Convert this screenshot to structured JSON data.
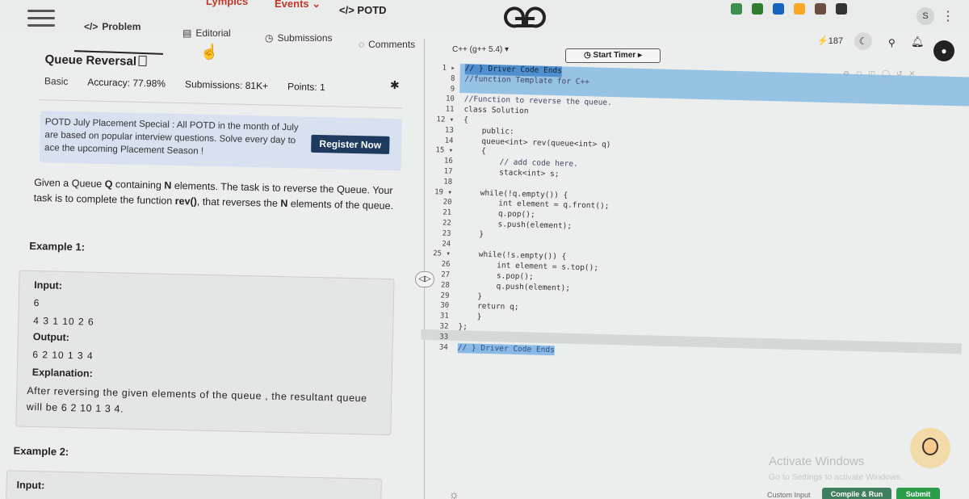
{
  "topbar": {
    "nav_olympics": "Lympics",
    "nav_events": "Events",
    "nav_potd": "POTD",
    "extensions": [
      "#3c8d4e",
      "#2e7d32",
      "#1565c0",
      "#f9a825",
      "#6d4c41",
      "#333333"
    ],
    "profile_initial": "S",
    "streak_count": "187"
  },
  "tabs": [
    {
      "label": "Problem",
      "icon": "code-icon"
    },
    {
      "label": "Editorial",
      "icon": "doc-icon"
    },
    {
      "label": "Submissions",
      "icon": "clock-icon"
    },
    {
      "label": "Comments",
      "icon": "comment-icon"
    }
  ],
  "problem": {
    "title": "Queue Reversal",
    "difficulty": "Basic",
    "accuracy": "Accuracy: 77.98%",
    "submissions": "Submissions: 81K+",
    "points": "Points: 1",
    "banner_text": "POTD July Placement Special : All POTD in the month of July are based on popular interview questions. Solve every day to ace the upcoming Placement Season !",
    "register_label": "Register Now",
    "desc_part1": "Given a Queue ",
    "desc_q": "Q",
    "desc_part2": " containing ",
    "desc_n": "N",
    "desc_part3": " elements. The task is to reverse the Queue. Your task is to complete the function ",
    "desc_fn": "rev()",
    "desc_part4": ", that reverses the ",
    "desc_n2": "N",
    "desc_part5": " elements of the queue.",
    "example1_heading": "Example 1:",
    "input_label": "Input:",
    "input_n": "6",
    "input_values": "4 3 1 10 2 6",
    "output_label": "Output:",
    "output_values": "6 2 10 1 3 4",
    "explanation_label": "Explanation:",
    "explanation_text": "After reversing the given elements of the queue , the resultant queue will be 6 2 10 1 3 4.",
    "example2_heading": "Example 2:",
    "example2_input_label": "Input:"
  },
  "editor": {
    "language": "C++ (g++ 5.4) ▾",
    "timer_label": "Start Timer",
    "line_numbers": [
      "1 ▸",
      "8",
      "9",
      "10",
      "11",
      "12 ▾",
      "13",
      "14",
      "15 ▾",
      "16",
      "17",
      "18",
      "19 ▾",
      "20",
      "21",
      "22",
      "23",
      "24",
      "25 ▾",
      "26",
      "27",
      "28",
      "29",
      "30",
      "31",
      "32",
      "33",
      "34"
    ],
    "code_lines": [
      "// } Driver Code Ends",
      "//function Template for C++",
      "",
      "//Function to reverse the queue.",
      "class Solution",
      "{",
      "    public:",
      "    queue<int> rev(queue<int> q)",
      "    {",
      "        // add code here.",
      "        stack<int> s;",
      "",
      "    while(!q.empty()) {",
      "        int element = q.front();",
      "        q.pop();",
      "        s.push(element);",
      "    }",
      "",
      "    while(!s.empty()) {",
      "        int element = s.top();",
      "        s.pop();",
      "        q.push(element);",
      "    }",
      "    return q;",
      "    }",
      "};",
      "",
      "// } Driver Code Ends"
    ]
  },
  "footer": {
    "activate_title": "Activate Windows",
    "activate_sub": "Go to Settings to activate Windows.",
    "custom_input": "Custom Input",
    "compile_label": "Compile & Run",
    "submit_label": "Submit"
  }
}
